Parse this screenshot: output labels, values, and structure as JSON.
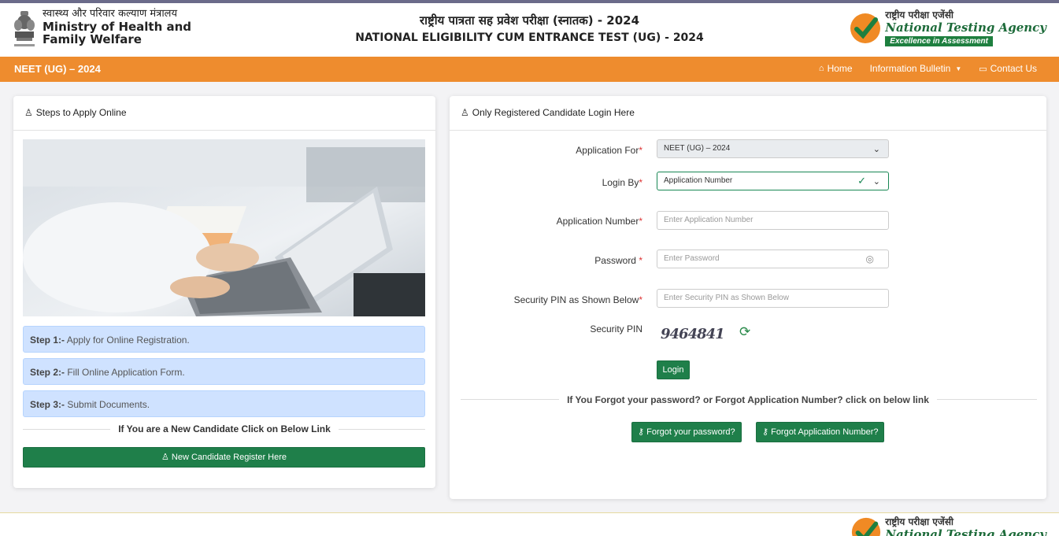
{
  "header": {
    "ministry_hi": "स्वास्थ्य और परिवार कल्याण मंत्रालय",
    "ministry_en_line1": "Ministry of Health and",
    "ministry_en_line2": "Family Welfare",
    "title_hi": "राष्ट्रीय पात्रता सह प्रवेश परीक्षा (स्नातक) - 2024",
    "title_en": "NATIONAL ELIGIBILITY CUM ENTRANCE TEST (UG) - 2024",
    "nta_hi": "राष्ट्रीय परीक्षा एजेंसी",
    "nta_en": "National Testing Agency",
    "nta_tagline": "Excellence in Assessment"
  },
  "nav": {
    "brand": "NEET (UG) – 2024",
    "home": "Home",
    "bulletin": "Information Bulletin",
    "contact": "Contact Us"
  },
  "left_panel": {
    "title": "Steps to Apply Online",
    "steps": [
      {
        "label": "Step 1:-",
        "text": " Apply for Online Registration."
      },
      {
        "label": "Step 2:-",
        "text": " Fill Online Application Form."
      },
      {
        "label": "Step 3:-",
        "text": " Submit Documents."
      }
    ],
    "new_candidate_text": "If You are a New Candidate Click on Below Link",
    "register_button": "New Candidate Register Here"
  },
  "login_panel": {
    "title": "Only Registered Candidate Login Here",
    "application_for_label": "Application For",
    "application_for_value": "NEET (UG) – 2024",
    "login_by_label": "Login By",
    "login_by_value": "Application Number",
    "app_number_label": "Application Number",
    "app_number_placeholder": "Enter Application Number",
    "password_label": "Password ",
    "password_placeholder": "Enter Password",
    "pin_label": "Security PIN as Shown Below",
    "pin_placeholder": "Enter Security PIN as Shown Below",
    "security_pin_label": "Security PIN",
    "captcha_value": "9464841",
    "required_mark": "*",
    "login_button": "Login",
    "forgot_text": "If You Forgot your password? or Forgot Application Number? click on below link",
    "forgot_password_button": "Forgot your password?",
    "forgot_appno_button": "Forgot Application Number?"
  },
  "colors": {
    "nav_orange": "#ee8c2e",
    "button_green": "#1f7f4a",
    "step_blue": "#cfe2ff"
  }
}
